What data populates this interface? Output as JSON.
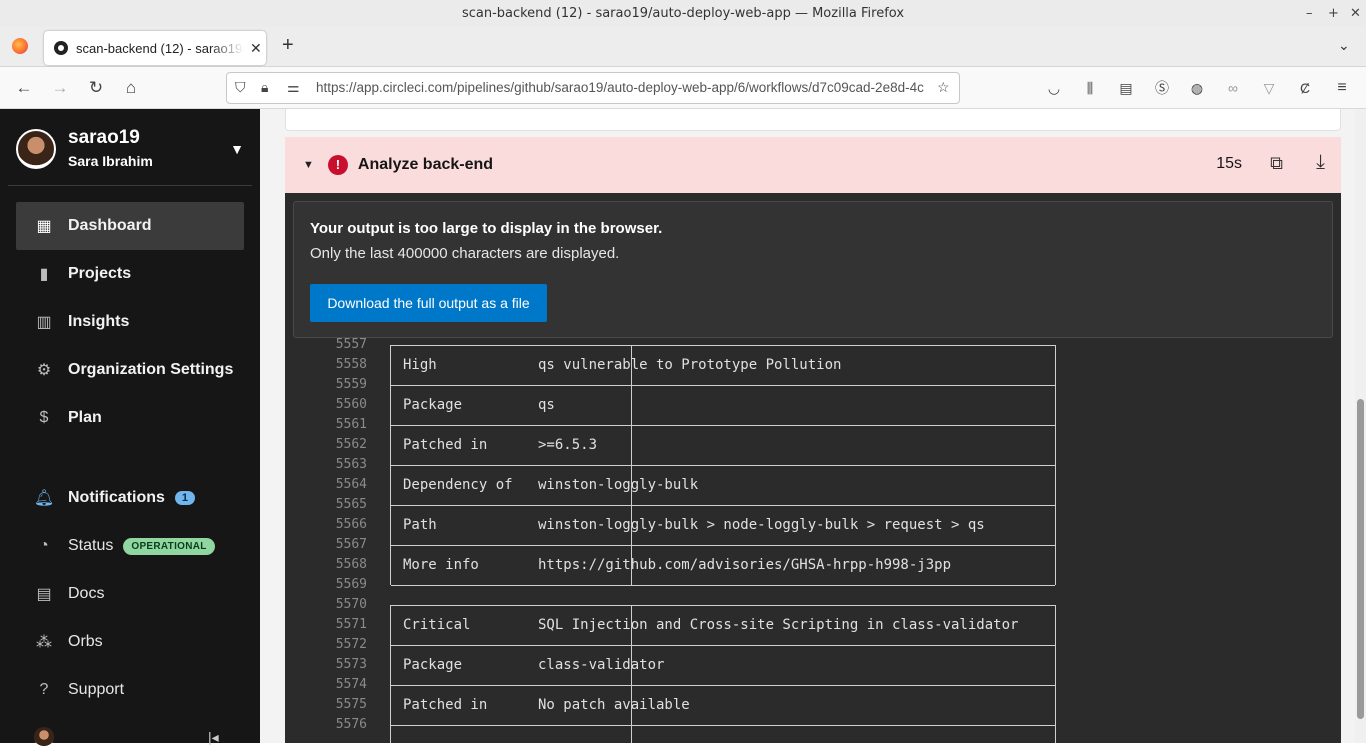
{
  "window": {
    "title": "scan-backend (12) - sarao19/auto-deploy-web-app — Mozilla Firefox"
  },
  "tab": {
    "title": "scan-backend (12) - sarao19/auto-deploy-web-app",
    "close": "✕",
    "new_tab": "+"
  },
  "nav": {
    "url": "https://app.circleci.com/pipelines/github/sarao19/auto-deploy-web-app/6/workflows/d7c09cad-2e8d-4c"
  },
  "sidebar": {
    "username": "sarao19",
    "fullname": "Sara Ibrahim",
    "items": [
      {
        "label": "Dashboard",
        "icon": "dashboard-icon"
      },
      {
        "label": "Projects",
        "icon": "book-icon"
      },
      {
        "label": "Insights",
        "icon": "chart-icon"
      },
      {
        "label": "Organization Settings",
        "icon": "gear-icon"
      },
      {
        "label": "Plan",
        "icon": "dollar-icon"
      }
    ],
    "notifications": {
      "label": "Notifications",
      "count": "1"
    },
    "status": {
      "label": "Status",
      "badge": "OPERATIONAL"
    },
    "docs": "Docs",
    "orbs": "Orbs",
    "support": "Support"
  },
  "step": {
    "name": "Analyze back-end",
    "duration": "15s"
  },
  "notice": {
    "title": "Your output is too large to display in the browser.",
    "subtitle": "Only the last 400000 characters are displayed.",
    "button": "Download the full output as a file"
  },
  "output": [
    {
      "n": "5557",
      "k": "",
      "v": ""
    },
    {
      "n": "5558",
      "k": "High",
      "v": "qs vulnerable to Prototype Pollution"
    },
    {
      "n": "5559",
      "k": "",
      "v": ""
    },
    {
      "n": "5560",
      "k": "Package",
      "v": "qs"
    },
    {
      "n": "5561",
      "k": "",
      "v": ""
    },
    {
      "n": "5562",
      "k": "Patched in",
      "v": ">=6.5.3"
    },
    {
      "n": "5563",
      "k": "",
      "v": ""
    },
    {
      "n": "5564",
      "k": "Dependency of",
      "v": "winston-loggly-bulk"
    },
    {
      "n": "5565",
      "k": "",
      "v": ""
    },
    {
      "n": "5566",
      "k": "Path",
      "v": "winston-loggly-bulk > node-loggly-bulk > request > qs"
    },
    {
      "n": "5567",
      "k": "",
      "v": ""
    },
    {
      "n": "5568",
      "k": "More info",
      "v": "https://github.com/advisories/GHSA-hrpp-h998-j3pp"
    },
    {
      "n": "5569",
      "k": "",
      "v": ""
    },
    {
      "n": "5570",
      "k": "",
      "v": ""
    },
    {
      "n": "5571",
      "k": "Critical",
      "v": "SQL Injection and Cross-site Scripting in class-validator"
    },
    {
      "n": "5572",
      "k": "",
      "v": ""
    },
    {
      "n": "5573",
      "k": "Package",
      "v": "class-validator"
    },
    {
      "n": "5574",
      "k": "",
      "v": ""
    },
    {
      "n": "5575",
      "k": "Patched in",
      "v": "No patch available"
    },
    {
      "n": "5576",
      "k": "",
      "v": ""
    }
  ]
}
